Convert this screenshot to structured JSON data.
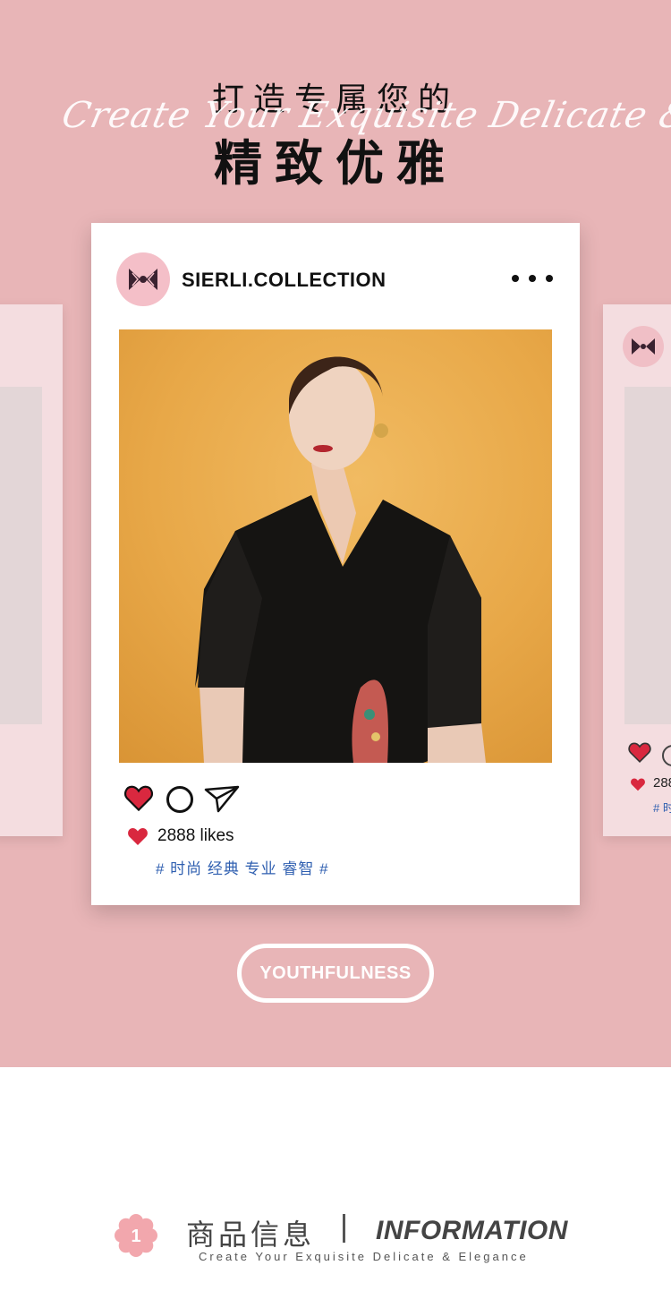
{
  "hero": {
    "title_small": "打造专属您的",
    "script": "Create Your Exquisite Delicate & Elegance",
    "title_big": "精致优雅"
  },
  "post": {
    "username": "SIERLI.COLLECTION",
    "likes": "2888 likes",
    "tags": "# 时尚 经典 专业 睿智 #"
  },
  "side_post": {
    "likes": "288",
    "tag": "# 时"
  },
  "badge": {
    "label": "YOUTHFULNESS"
  },
  "info": {
    "number": "1",
    "cn_title": "商品信息",
    "en_title": "INFORMATION",
    "subtitle": "Create Your Exquisite Delicate & Elegance"
  },
  "colors": {
    "background": "#e8b5b7",
    "heart": "#d9283f",
    "tag_blue": "#2f5fb0",
    "card": "#ffffff"
  },
  "icons": [
    "logo-icon",
    "more-icon",
    "heart-icon",
    "comment-icon",
    "send-icon",
    "flower-icon"
  ]
}
